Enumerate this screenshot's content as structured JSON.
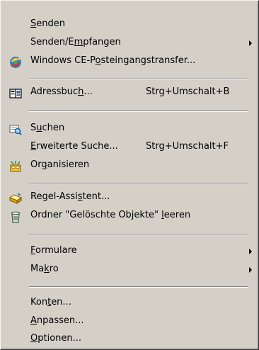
{
  "menu": {
    "items": [
      {
        "pre": "",
        "u": "S",
        "post": "enden",
        "shortcut": "",
        "submenu": false,
        "icon": ""
      },
      {
        "pre": "Senden/E",
        "u": "m",
        "post": "pfangen",
        "shortcut": "",
        "submenu": true,
        "icon": ""
      },
      {
        "pre": "Windows CE-P",
        "u": "o",
        "post": "steingangstransfer...",
        "shortcut": "",
        "submenu": false,
        "icon": "sync-arrows-icon"
      },
      {
        "pre": "Adressbuc",
        "u": "h",
        "post": "...",
        "shortcut": "Strg+Umschalt+B",
        "submenu": false,
        "icon": "address-book-icon"
      },
      {
        "pre": "S",
        "u": "u",
        "post": "chen",
        "shortcut": "",
        "submenu": false,
        "icon": "find-icon"
      },
      {
        "pre": "",
        "u": "E",
        "post": "rweiterte Suche...",
        "shortcut": "Strg+Umschalt+F",
        "submenu": false,
        "icon": ""
      },
      {
        "pre": "Or",
        "u": "g",
        "post": "anisieren",
        "shortcut": "",
        "submenu": false,
        "icon": "organize-icon"
      },
      {
        "pre": "Regel-Assi",
        "u": "s",
        "post": "tent...",
        "shortcut": "",
        "submenu": false,
        "icon": "rules-wizard-icon"
      },
      {
        "pre": "Ordner \"Gelöschte Objekte\" ",
        "u": "l",
        "post": "eeren",
        "shortcut": "",
        "submenu": false,
        "icon": "recycle-bin-icon"
      },
      {
        "pre": "",
        "u": "F",
        "post": "ormulare",
        "shortcut": "",
        "submenu": true,
        "icon": ""
      },
      {
        "pre": "Ma",
        "u": "k",
        "post": "ro",
        "shortcut": "",
        "submenu": true,
        "icon": ""
      },
      {
        "pre": "Kon",
        "u": "t",
        "post": "en...",
        "shortcut": "",
        "submenu": false,
        "icon": ""
      },
      {
        "pre": "",
        "u": "A",
        "post": "npassen...",
        "shortcut": "",
        "submenu": false,
        "icon": ""
      },
      {
        "pre": "",
        "u": "O",
        "post": "ptionen...",
        "shortcut": "",
        "submenu": false,
        "icon": ""
      }
    ]
  }
}
